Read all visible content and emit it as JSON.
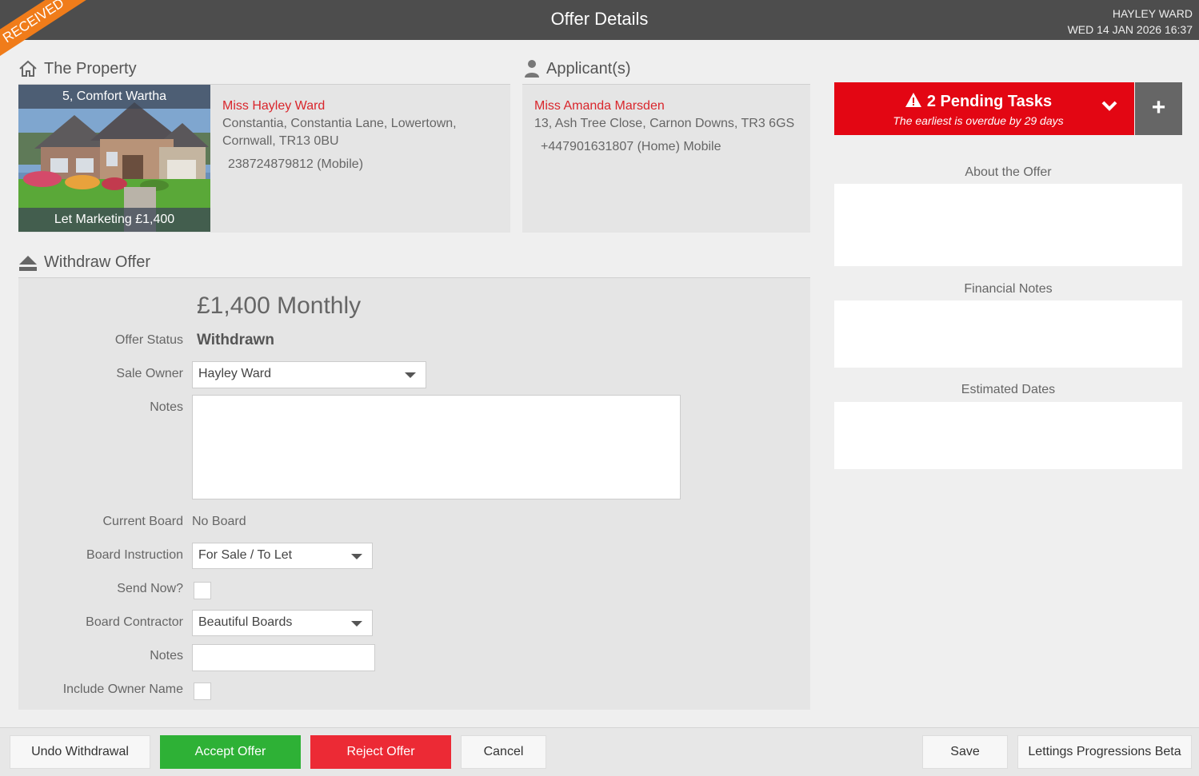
{
  "header": {
    "title": "Offer Details",
    "user_name": "HAYLEY WARD",
    "datetime": "WED 14 JAN 2026 16:37",
    "ribbon": "RECEIVED"
  },
  "property": {
    "heading": "The Property",
    "photo_title": "5, Comfort Wartha",
    "photo_caption": "Let Marketing £1,400",
    "owner_name": "Miss Hayley Ward",
    "address_line1": "Constantia, Constantia Lane, Lowertown,",
    "address_line2": "Cornwall, TR13 0BU",
    "phone": "238724879812 (Mobile)"
  },
  "applicant": {
    "heading": "Applicant(s)",
    "name": "Miss Amanda Marsden",
    "address": "13, Ash Tree Close, Carnon Downs, TR3 6GS",
    "phone": "+447901631807 (Home) Mobile"
  },
  "withdraw": {
    "heading": "Withdraw Offer",
    "amount": "£1,400 Monthly",
    "offer_status_label": "Offer Status",
    "offer_status_value": "Withdrawn",
    "sale_owner_label": "Sale Owner",
    "sale_owner_value": "Hayley Ward",
    "notes_label": "Notes",
    "notes_value": "",
    "current_board_label": "Current Board",
    "current_board_value": "No Board",
    "board_instruction_label": "Board Instruction",
    "board_instruction_value": "For Sale / To Let",
    "send_now_label": "Send Now?",
    "send_now_checked": false,
    "board_contractor_label": "Board Contractor",
    "board_contractor_value": "Beautiful Boards",
    "notes2_label": "Notes",
    "notes2_value": "",
    "include_owner_label": "Include Owner Name",
    "include_owner_checked": false
  },
  "tasks": {
    "title": "2 Pending Tasks",
    "subtitle": "The earliest is overdue by 29 days",
    "add_label": "+",
    "color": "#e30613"
  },
  "right": {
    "about_label": "About the Offer",
    "financial_label": "Financial Notes",
    "dates_label": "Estimated Dates"
  },
  "footer": {
    "undo": "Undo Withdrawal",
    "accept": "Accept Offer",
    "reject": "Reject Offer",
    "cancel": "Cancel",
    "save": "Save",
    "lettings": "Lettings Progressions Beta"
  },
  "colors": {
    "accent_red": "#d9262c",
    "accept_green": "#2eb136",
    "reject_red": "#ec2a35",
    "ribbon_orange": "#f07c1a",
    "header_bg": "#4d4d4d"
  },
  "icons": {
    "property": "house-icon",
    "applicant": "person-icon",
    "withdraw": "eject-icon",
    "tasks": "warning-icon",
    "expand": "chevron-down-icon"
  }
}
